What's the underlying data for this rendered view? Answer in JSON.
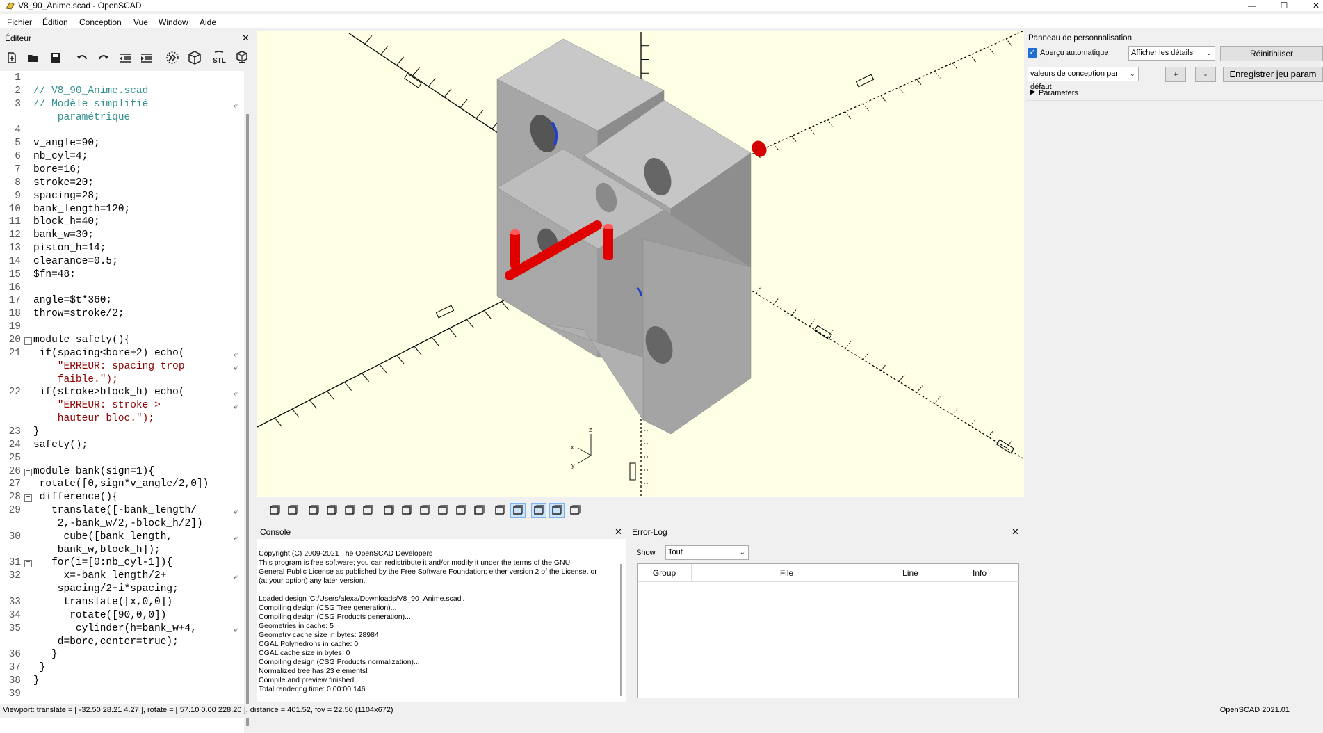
{
  "window": {
    "title": "V8_90_Anime.scad - OpenSCAD",
    "minimize": "—",
    "maximize": "☐",
    "close": "✕"
  },
  "menu": [
    "Fichier",
    "Édition",
    "Conception",
    "Vue",
    "Window",
    "Aide"
  ],
  "editor": {
    "title": "Éditeur",
    "close": "✕",
    "toolbar_icons": [
      "new-file-icon",
      "open-file-icon",
      "save-icon",
      "undo-icon",
      "redo-icon",
      "unindent-icon",
      "indent-icon",
      "preview-icon",
      "render-icon",
      "export-stl-icon",
      "send-to-print-icon"
    ],
    "stl_label": "STL",
    "lines": [
      {
        "n": "1",
        "text": ""
      },
      {
        "n": "2",
        "text": "// V8_90_Anime.scad",
        "cls": "cmt"
      },
      {
        "n": "3",
        "text": "// Modèle simplifié",
        "cls": "cmt",
        "wrap": true
      },
      {
        "n": "",
        "text": "    paramétrique",
        "cls": "cmt"
      },
      {
        "n": "4",
        "text": ""
      },
      {
        "n": "5",
        "text": "v_angle=90;"
      },
      {
        "n": "6",
        "text": "nb_cyl=4;"
      },
      {
        "n": "7",
        "text": "bore=16;"
      },
      {
        "n": "8",
        "text": "stroke=20;"
      },
      {
        "n": "9",
        "text": "spacing=28;"
      },
      {
        "n": "10",
        "text": "bank_length=120;"
      },
      {
        "n": "11",
        "text": "block_h=40;"
      },
      {
        "n": "12",
        "text": "bank_w=30;"
      },
      {
        "n": "13",
        "text": "piston_h=14;"
      },
      {
        "n": "14",
        "text": "clearance=0.5;"
      },
      {
        "n": "15",
        "text": "$fn=48;"
      },
      {
        "n": "16",
        "text": ""
      },
      {
        "n": "17",
        "text": "angle=$t*360;"
      },
      {
        "n": "18",
        "text": "throw=stroke/2;"
      },
      {
        "n": "19",
        "text": ""
      },
      {
        "n": "20",
        "text": "module safety(){",
        "fold": "−"
      },
      {
        "n": "21",
        "text": " if(spacing<bore+2) echo(",
        "wrap": true
      },
      {
        "n": "",
        "text": "    \"ERREUR: spacing trop",
        "cls": "str",
        "wrap": true
      },
      {
        "n": "",
        "text": "    faible.\");",
        "cls": "str"
      },
      {
        "n": "22",
        "text": " if(stroke>block_h) echo(",
        "wrap": true
      },
      {
        "n": "",
        "text": "    \"ERREUR: stroke >",
        "cls": "str",
        "wrap": true
      },
      {
        "n": "",
        "text": "    hauteur bloc.\");",
        "cls": "str"
      },
      {
        "n": "23",
        "text": "}"
      },
      {
        "n": "24",
        "text": "safety();"
      },
      {
        "n": "25",
        "text": ""
      },
      {
        "n": "26",
        "text": "module bank(sign=1){",
        "fold": "−"
      },
      {
        "n": "27",
        "text": " rotate([0,sign*v_angle/2,0])"
      },
      {
        "n": "28",
        "text": " difference(){",
        "fold": "−"
      },
      {
        "n": "29",
        "text": "   translate([-bank_length/",
        "wrap": true
      },
      {
        "n": "",
        "text": "    2,-bank_w/2,-block_h/2])"
      },
      {
        "n": "30",
        "text": "     cube([bank_length,",
        "wrap": true
      },
      {
        "n": "",
        "text": "    bank_w,block_h]);"
      },
      {
        "n": "31",
        "text": "   for(i=[0:nb_cyl-1]){",
        "fold": "−"
      },
      {
        "n": "32",
        "text": "     x=-bank_length/2+",
        "wrap": true
      },
      {
        "n": "",
        "text": "    spacing/2+i*spacing;"
      },
      {
        "n": "33",
        "text": "     translate([x,0,0])"
      },
      {
        "n": "34",
        "text": "      rotate([90,0,0])"
      },
      {
        "n": "35",
        "text": "       cylinder(h=bank_w+4,",
        "wrap": true
      },
      {
        "n": "",
        "text": "    d=bore,center=true);"
      },
      {
        "n": "36",
        "text": "   }"
      },
      {
        "n": "37",
        "text": " }"
      },
      {
        "n": "38",
        "text": "}"
      },
      {
        "n": "39",
        "text": ""
      }
    ]
  },
  "viewport": {
    "axis_labels": {
      "x": "x",
      "y": "y",
      "z": "z"
    },
    "background": "#ffffe5",
    "part_color": "#a8a8a8",
    "piston_color": "#e00000"
  },
  "view_toolbar_icons": [
    "preview-icon",
    "render-icon",
    "view-all-icon",
    "zoom-in-icon",
    "zoom-out-icon",
    "reset-view-icon",
    "view-right-icon",
    "view-top-icon",
    "view-bottom-icon",
    "view-left-icon",
    "view-front-icon",
    "view-back-icon",
    "perspective-icon",
    "orthogonal-icon",
    "show-axes-icon",
    "show-scale-icon",
    "show-edges-icon"
  ],
  "console": {
    "title": "Console",
    "close": "✕",
    "lines": [
      "Copyright (C) 2009-2021 The OpenSCAD Developers",
      "This program is free software; you can redistribute it and/or modify it under the terms of the GNU",
      "General Public License as published by the Free Software Foundation; either version 2 of the License, or",
      "(at your option) any later version.",
      "",
      "Loaded design 'C:/Users/alexa/Downloads/V8_90_Anime.scad'.",
      "Compiling design (CSG Tree generation)...",
      "Compiling design (CSG Products generation)...",
      "Geometries in cache: 5",
      "Geometry cache size in bytes: 28984",
      "CGAL Polyhedrons in cache: 0",
      "CGAL cache size in bytes: 0",
      "Compiling design (CSG Products normalization)...",
      "Normalized tree has 23 elements!",
      "Compile and preview finished.",
      "Total rendering time: 0:00:00.146"
    ]
  },
  "errorlog": {
    "title": "Error-Log",
    "close": "✕",
    "show_label": "Show",
    "show_value": "Tout",
    "columns": [
      "Group",
      "File",
      "Line",
      "Info"
    ]
  },
  "customizer": {
    "title": "Panneau de personnalisation",
    "auto_preview_label": "Aperçu automatique",
    "auto_preview_checked": true,
    "details_select": "Afficher les détails",
    "reset_button": "Réinitialiser",
    "preset_select": "valeurs de conception par défaut",
    "add_button": "+",
    "remove_button": "-",
    "save_button": "Enregistrer jeu param",
    "group": "Parameters"
  },
  "statusbar": {
    "viewport_info": "Viewport: translate = [ -32.50 28.21 4.27 ], rotate = [ 57.10 0.00 228.20 ], distance = 401.52, fov = 22.50 (1104x672)",
    "version": "OpenSCAD 2021.01"
  }
}
